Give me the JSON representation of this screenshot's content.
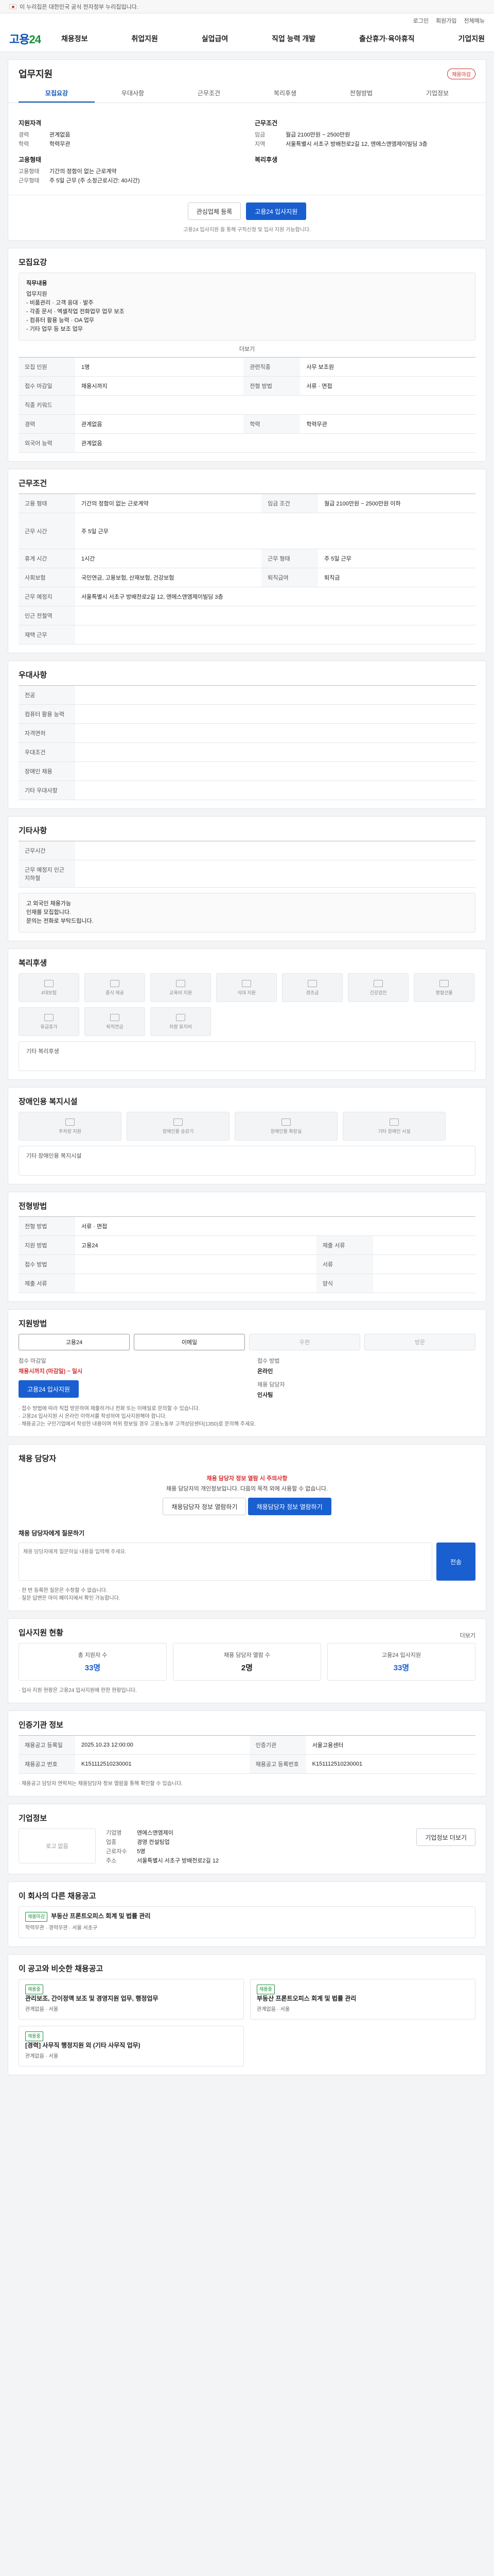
{
  "topbar": {
    "text": "이 누리집은 대한민국 공식 전자정부 누리집입니다."
  },
  "util": [
    "로그인",
    "회원가입",
    "전체메뉴"
  ],
  "brand": {
    "logo_main": "고용",
    "logo_sub": "24"
  },
  "gnb": [
    "채용정보",
    "취업지원",
    "실업급여",
    "직업 능력 개발",
    "출산휴가·육아휴직",
    "기업지원"
  ],
  "job": {
    "title": "업무지원",
    "badge": "채용마감",
    "tabs": [
      "모집요강",
      "우대사항",
      "근무조건",
      "복리후생",
      "전형방법",
      "기업정보"
    ],
    "company_label": "지원자격",
    "company": [
      {
        "k": "경력",
        "v": "관계없음"
      },
      {
        "k": "학력",
        "v": "학력무관"
      }
    ],
    "work_label": "근무조건",
    "work": [
      {
        "k": "임금",
        "v": "월급 2100만원 ~ 2500만원"
      },
      {
        "k": "지역",
        "v": "서울특별시 서초구 방배천로2길 12, 엔에스앤엠제이빌딩 3층"
      }
    ],
    "emp_label": "고용형태",
    "emp": [
      {
        "k": "고용형태",
        "v": "기간의 정함이 없는 근로계약"
      },
      {
        "k": "근무형태",
        "v": "주 5일 근무 (주 소정근로시간: 40시간)"
      }
    ],
    "welfare_label": "복리후생",
    "apply_scrap": "관심업체 등록",
    "apply_main": "고용24 입사지원",
    "notice": "고용24 입사지원 을 통해 구직신청 및 입사 지원 가능합니다."
  },
  "recruit": {
    "title": "모집요강",
    "desc_label": "직무내용",
    "desc": [
      "업무지원",
      "",
      "- 비품관리 · 고객 응대 · 발주",
      "- 각종 문서 · 엑셀작업 전화업무 업무 보조",
      "- 컴퓨터 활용 능력 · OA 업무",
      "- 기타 업무 등 보조 업무"
    ],
    "more": "더보기",
    "rows": [
      {
        "k": "모집 인원",
        "v": "1명",
        "k2": "관련직종",
        "v2": "사무 보조원"
      },
      {
        "k": "접수 마감일",
        "v": "채용시까지",
        "k2": "전형 방법",
        "v2": "서류 · 면접"
      },
      {
        "k": "직종 키워드",
        "v": "",
        "k2": "",
        "v2": ""
      },
      {
        "k": "경력",
        "v": "관계없음",
        "k2": "학력",
        "v2": "학력무관"
      },
      {
        "k": "외국어 능력",
        "v": "관계없음",
        "k2": "",
        "v2": ""
      }
    ]
  },
  "conditions": {
    "title": "근무조건",
    "rows": [
      {
        "k": "고용 형태",
        "v": "기간의 정함이 없는 근로계약",
        "k2": "임금 조건",
        "v2": "월급 2100만원 ~ 2500만원 이하"
      },
      {
        "k": "근무 시간",
        "v": "주 5일 근무",
        "k2": "",
        "v2": ""
      },
      {
        "k": "휴게 시간",
        "v": "1시간",
        "k2": "근무 형태",
        "v2": "주 5일 근무"
      },
      {
        "k": "사회보험",
        "v": "국민연금, 고용보험, 산재보험, 건강보험",
        "k2": "퇴직급여",
        "v2": "퇴직금"
      },
      {
        "k": "근무 예정지",
        "v": "서울특별시 서초구 방배천로2길 12, 엔에스앤엠제이빌딩 3층",
        "k2": "",
        "v2": ""
      },
      {
        "k": "인근 전철역",
        "v": "",
        "k2": "",
        "v2": ""
      },
      {
        "k": "재택 근무",
        "v": "",
        "k2": "",
        "v2": ""
      }
    ]
  },
  "preference": {
    "title": "우대사항",
    "rows": [
      "전공",
      "컴퓨터 활용 능력",
      "자격면허",
      "우대조건",
      "장애인 채용",
      "기타 우대사항"
    ]
  },
  "etc": {
    "title": "기타사항",
    "rows": [
      {
        "k": "근무시간",
        "v": ""
      },
      {
        "k": "근무 예정지 인근 지하철",
        "v": ""
      }
    ],
    "memo": [
      "고 외국인 채용가능",
      "인재를 모집합니다.",
      "문의는 전화로 부탁드립니다."
    ]
  },
  "welfare": {
    "title": "복리후생",
    "items": [
      "4대보험",
      "중식 제공",
      "교육비 지원",
      "식대 지원",
      "경조금",
      "건강검진",
      "명절선물",
      "유급휴가",
      "퇴직연금",
      "차량 유지비"
    ],
    "etc_label": "기타 복리후생"
  },
  "disability": {
    "title": "장애인용 복지시설",
    "items": [
      "주차장 지원",
      "장애인용 승강기",
      "장애인용 화장실",
      "기타 장애인 시설"
    ],
    "etc_label": "기타 장애인용 복지시설"
  },
  "process": {
    "title": "전형방법",
    "rows": [
      {
        "k": "전형 방법",
        "v": "서류 · 면접",
        "k2": "",
        "v2": ""
      },
      {
        "k": "지원 방법",
        "v": "고용24",
        "k2": "제출 서류",
        "v2": ""
      },
      {
        "k": "접수 방법",
        "v": "",
        "k2": "서류",
        "v2": ""
      },
      {
        "k": "제출 서류",
        "v": "",
        "k2": "양식",
        "v2": ""
      }
    ]
  },
  "apply_method": {
    "title": "지원방법",
    "options": [
      "고용24",
      "이메일",
      "우편",
      "방문"
    ],
    "period_k": "접수 마감일",
    "period_v": "채용시까지 (마감일) ~ 일시",
    "deadline_k": "접수 방법",
    "deadline_v": "온라인",
    "apply_btn": "고용24 입사지원",
    "manager_k": "채용 담당자",
    "manager_v": "인사팀",
    "bullets": [
      "· 접수 방법에 따라 직접 방문하여 제출하거나 전화 또는 이메일로 문의할 수 있습니다.",
      "· 고용24 입사지원 시 온라인 이력서를 작성하여 입사지원해야 합니다.",
      "· 채용공고는 구인기업에서 작성한 내용이며 허위 정보일 경우 고용노동부 고객상담센터(1350)로 문의해 주세요."
    ]
  },
  "contact": {
    "title": "채용 담당자",
    "line1": "채용 담당자 정보 열람 시 주의사항",
    "line2": "채용 담당자의 개인정보입니다. 다음의 목적 외에 사용할 수 없습니다.",
    "btn1": "채용담당자 정보 열람하기",
    "btn2": "채용담당자 정보 열람하기"
  },
  "qa": {
    "title": "채용 담당자에게 질문하기",
    "placeholder": "채용 담당자에게 질문하실 내용을 입력해 주세요.",
    "submit": "전송",
    "notes": [
      "· 한 번 등록한 질문은 수정할 수 없습니다.",
      "· 질문 답변은 마이 페이지에서 확인 가능합니다."
    ]
  },
  "stats": {
    "title": "입사지원 현황",
    "more": "더보기",
    "items": [
      {
        "k": "총 지원자 수",
        "v": "33명"
      },
      {
        "k": "채용 담당자 열람 수",
        "v": "2명"
      },
      {
        "k": "고용24 입사지원",
        "v": "33명"
      }
    ],
    "note": "· 입사 지원 현황은 고용24 입사지원에 한한 현황입니다."
  },
  "info": {
    "title": "인증기관 정보",
    "rows": [
      {
        "k": "채용공고 등록일",
        "v": "2025.10.23 12:00:00",
        "k2": "인증기관",
        "v2": "서울고용센터"
      },
      {
        "k": "채용공고 번호",
        "v": "K151112510230001",
        "k2": "채용공고 등록번호",
        "v2": "K151112510230001"
      }
    ],
    "note": "· 채용공고 담당자 연락처는 채용담당자 정보 열람을 통해 확인할 수 있습니다."
  },
  "company": {
    "title": "기업정보",
    "logo": "로고 없음",
    "rows": [
      {
        "k": "기업명",
        "v": "엔에스앤엠제이"
      },
      {
        "k": "업종",
        "v": "경영 컨설팅업"
      },
      {
        "k": "근로자수",
        "v": "5명"
      },
      {
        "k": "주소",
        "v": "서울특별시 서초구 방배천로2길 12"
      }
    ],
    "btn": "기업정보 더보기"
  },
  "similar": {
    "title": "이 회사의 다른 채용공고",
    "item": {
      "tag": "채용마감",
      "title": "부동산 프론트오피스 회계 및 법률 관리",
      "meta": "학력무관 · 경력무관 · 서울 서초구"
    }
  },
  "recommend": {
    "title": "이 공고와 비슷한 채용공고",
    "items": [
      {
        "tag": "채용중",
        "title": "관리보조, 간이정액 보조 및 경영지원 업무, 행정업무",
        "meta": "관계없음 · 서울"
      },
      {
        "tag": "채용중",
        "title": "부동산 프론트오피스 회계 및 법률 관리",
        "meta": "관계없음 · 서울"
      },
      {
        "tag": "채용중",
        "title": "[경력] 사무직 행정지원 외 (기타 사무직 업무)",
        "meta": "관계없음 · 서울"
      }
    ]
  }
}
